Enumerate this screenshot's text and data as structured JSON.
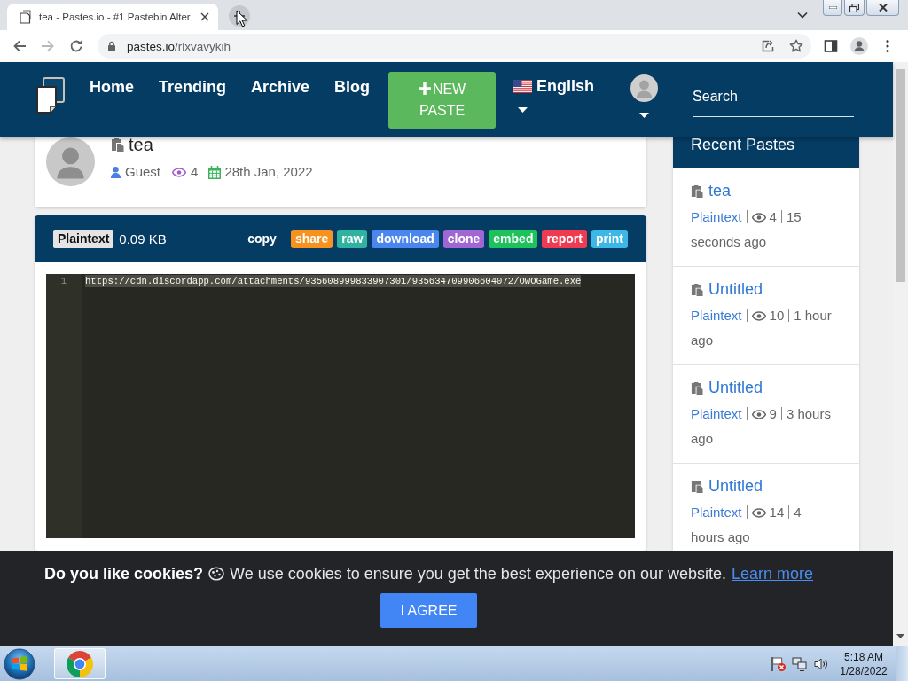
{
  "browser": {
    "tab": {
      "title": "tea - Pastes.io - #1 Pastebin Alter"
    },
    "address": {
      "domain": "pastes.io",
      "path": "/rlxvavykih"
    }
  },
  "navbar": {
    "links": [
      {
        "label": "Home"
      },
      {
        "label": "Trending"
      },
      {
        "label": "Archive"
      },
      {
        "label": "Blog"
      }
    ],
    "new_paste": {
      "label": "NEW PASTE"
    },
    "language": {
      "label": "English"
    },
    "search": {
      "placeholder": "Search"
    }
  },
  "paste": {
    "title": "tea",
    "author": "Guest",
    "views": "4",
    "date": "28th Jan, 2022",
    "language": "Plaintext",
    "size": "0.09 KB",
    "actions": [
      {
        "label": "copy"
      },
      {
        "label": "share",
        "color": "#f7921e"
      },
      {
        "label": "raw",
        "color": "#2fb3a0"
      },
      {
        "label": "download",
        "color": "#4b86ef"
      },
      {
        "label": "clone",
        "color": "#a066d3"
      },
      {
        "label": "embed",
        "color": "#1dc25b"
      },
      {
        "label": "report",
        "color": "#f03a50"
      },
      {
        "label": "print",
        "color": "#3db7e6"
      }
    ],
    "code": {
      "lines": [
        {
          "number": "1",
          "text": "https://cdn.discordapp.com/attachments/935608999833907301/935634709906604072/OwOGame.exe",
          "highlighted": true
        }
      ]
    }
  },
  "recent_pastes": {
    "title": "Recent Pastes",
    "items": [
      {
        "title": "tea",
        "language": "Plaintext",
        "views": "4",
        "time": "15 seconds ago"
      },
      {
        "title": "Untitled",
        "language": "Plaintext",
        "views": "10",
        "time": "1 hour ago"
      },
      {
        "title": "Untitled",
        "language": "Plaintext",
        "views": "9",
        "time": "3 hours ago"
      },
      {
        "title": "Untitled",
        "language": "Plaintext",
        "views": "14",
        "time": "4 hours ago"
      }
    ]
  },
  "cookie_banner": {
    "question": "Do you like cookies?",
    "message": "We use cookies to ensure you get the best experience on our website.",
    "link": "Learn more",
    "button": "I AGREE"
  },
  "taskbar": {
    "clock": {
      "time": "5:18 AM",
      "date": "1/28/2022"
    }
  }
}
